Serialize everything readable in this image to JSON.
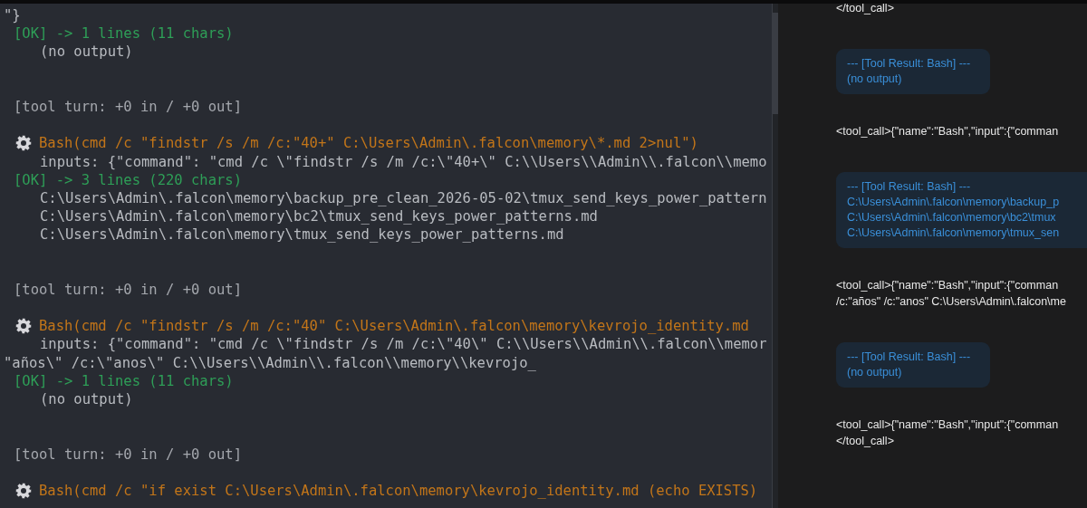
{
  "terminal": {
    "lines": [
      {
        "kind": "plain",
        "text": "\"}"
      },
      {
        "kind": "ok",
        "text": "[OK] -> 1 lines (11 chars)"
      },
      {
        "kind": "output",
        "text": "(no output)"
      },
      {
        "kind": "turn",
        "text": "[tool turn: +0 in / +0 out]"
      },
      {
        "kind": "call",
        "text": "Bash(cmd /c \"findstr /s /m /c:\"40+\" C:\\Users\\Admin\\.falcon\\memory\\*.md 2>nul\")"
      },
      {
        "kind": "output",
        "text": "inputs: {\"command\": \"cmd /c \\\"findstr /s /m /c:\\\"40+\\\" C:\\\\Users\\\\Admin\\\\.falcon\\\\memo"
      },
      {
        "kind": "ok",
        "text": "[OK] -> 3 lines (220 chars)"
      },
      {
        "kind": "output",
        "text": "C:\\Users\\Admin\\.falcon\\memory\\backup_pre_clean_2026-05-02\\tmux_send_keys_power_pattern"
      },
      {
        "kind": "output",
        "text": "C:\\Users\\Admin\\.falcon\\memory\\bc2\\tmux_send_keys_power_patterns.md"
      },
      {
        "kind": "output",
        "text": "C:\\Users\\Admin\\.falcon\\memory\\tmux_send_keys_power_patterns.md"
      },
      {
        "kind": "turn",
        "text": "[tool turn: +0 in / +0 out]"
      },
      {
        "kind": "call",
        "text": "Bash(cmd /c \"findstr /s /m /c:\"40\" C:\\Users\\Admin\\.falcon\\memory\\kevrojo_identity.md"
      },
      {
        "kind": "output",
        "text": "inputs: {\"command\": \"cmd /c \\\"findstr /s /m /c:\\\"40\\\" C:\\\\Users\\\\Admin\\\\.falcon\\\\memor"
      },
      {
        "kind": "plain",
        "text": "\"años\\\" /c:\\\"anos\\\" C:\\\\Users\\\\Admin\\\\.falcon\\\\memory\\\\kevrojo_"
      },
      {
        "kind": "ok",
        "text": "[OK] -> 1 lines (11 chars)"
      },
      {
        "kind": "output",
        "text": "(no output)"
      },
      {
        "kind": "turn",
        "text": "[tool turn: +0 in / +0 out]"
      },
      {
        "kind": "call",
        "text": "Bash(cmd /c \"if exist C:\\Users\\Admin\\.falcon\\memory\\kevrojo_identity.md (echo EXISTS)"
      }
    ]
  },
  "chat": {
    "items": [
      {
        "kind": "text",
        "lines": [
          "</tool_call>"
        ]
      },
      {
        "kind": "result",
        "lines": [
          "--- [Tool Result: Bash] ---",
          "(no output)"
        ]
      },
      {
        "kind": "text",
        "lines": [
          "<tool_call>{\"name\":\"Bash\",\"input\":{\"comman"
        ]
      },
      {
        "kind": "result",
        "lines": [
          "--- [Tool Result: Bash] ---",
          "C:\\Users\\Admin\\.falcon\\memory\\backup_p",
          "C:\\Users\\Admin\\.falcon\\memory\\bc2\\tmux",
          "C:\\Users\\Admin\\.falcon\\memory\\tmux_sen"
        ]
      },
      {
        "kind": "text",
        "lines": [
          "<tool_call>{\"name\":\"Bash\",\"input\":{\"comman",
          "/c:\"años\" /c:\"anos\" C:\\Users\\Admin\\.falcon\\me"
        ]
      },
      {
        "kind": "result",
        "lines": [
          "--- [Tool Result: Bash] ---",
          "(no output)"
        ]
      },
      {
        "kind": "text",
        "lines": [
          "<tool_call>{\"name\":\"Bash\",\"input\":{\"comman",
          "</tool_call>"
        ]
      }
    ]
  }
}
